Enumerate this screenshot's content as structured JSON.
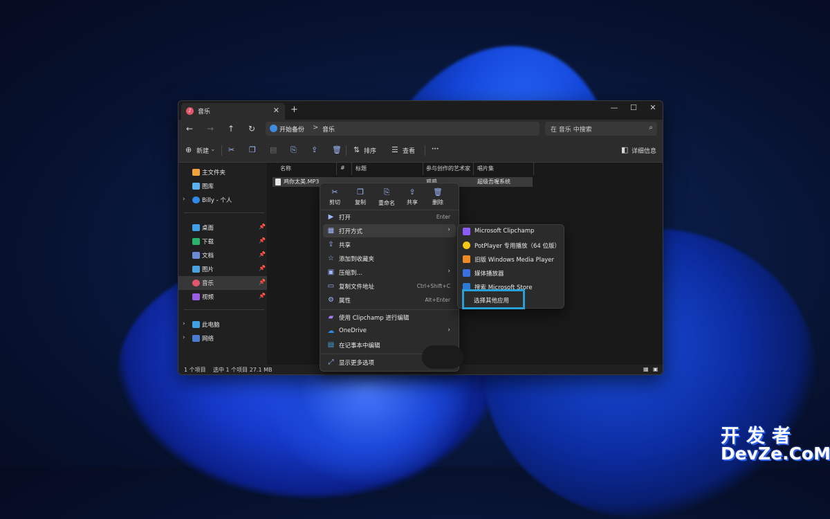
{
  "window": {
    "tab_title": "音乐",
    "tab_close": "✕",
    "tab_add": "+",
    "controls": {
      "minimize": "—",
      "maximize": "☐",
      "close": "✕"
    }
  },
  "address_bar": {
    "back": "←",
    "forward": "→",
    "up": "↑",
    "refresh": "↻",
    "path": [
      "开始备份",
      "音乐"
    ],
    "separator": ">",
    "search_placeholder": "在 音乐 中搜索"
  },
  "toolbar": {
    "new_label": "新建",
    "sort_label": "排序",
    "view_label": "查看",
    "more": "···",
    "details_label": "详细信息"
  },
  "sidebar": {
    "top_items": [
      {
        "label": "主文件夹",
        "icon": "home-icon"
      },
      {
        "label": "图库",
        "icon": "gallery-icon"
      },
      {
        "label": "Billy - 个人",
        "icon": "onedrive-icon"
      }
    ],
    "pinned_items": [
      {
        "label": "桌面",
        "icon": "desktop-icon"
      },
      {
        "label": "下载",
        "icon": "download-icon"
      },
      {
        "label": "文档",
        "icon": "documents-icon"
      },
      {
        "label": "图片",
        "icon": "pictures-icon"
      },
      {
        "label": "音乐",
        "icon": "music-icon",
        "selected": true
      },
      {
        "label": "视频",
        "icon": "videos-icon"
      }
    ],
    "bottom_items": [
      {
        "label": "此电脑",
        "icon": "pc-icon"
      },
      {
        "label": "网络",
        "icon": "network-icon"
      }
    ]
  },
  "file_list": {
    "columns": [
      "名称",
      "#",
      "标题",
      "参与创作的艺术家",
      "唱片集"
    ],
    "rows": [
      {
        "name": "鸡你太美.MP3",
        "artist": "鸡鸡",
        "album": "超级吾喔系统"
      }
    ]
  },
  "status_bar": {
    "count": "1 个项目",
    "selection": "选中 1 个项目 27.1 MB"
  },
  "context_menu": {
    "top_actions": [
      {
        "label": "剪切",
        "icon": "cut-icon"
      },
      {
        "label": "复制",
        "icon": "copy-icon"
      },
      {
        "label": "重命名",
        "icon": "rename-icon"
      },
      {
        "label": "共享",
        "icon": "share-icon"
      },
      {
        "label": "删除",
        "icon": "delete-icon"
      }
    ],
    "items": [
      {
        "label": "打开",
        "shortcut": "Enter",
        "icon": "open-icon"
      },
      {
        "label": "打开方式",
        "submenu": true,
        "icon": "open-with-icon"
      },
      {
        "label": "共享",
        "icon": "share-icon"
      },
      {
        "label": "添加到收藏夹",
        "icon": "star-icon"
      },
      {
        "label": "压缩到...",
        "submenu": true,
        "icon": "zip-icon"
      },
      {
        "label": "复制文件地址",
        "shortcut": "Ctrl+Shift+C",
        "icon": "copy-path-icon"
      },
      {
        "label": "属性",
        "shortcut": "Alt+Enter",
        "icon": "properties-icon"
      },
      {
        "label": "使用 Clipchamp 进行编辑",
        "icon": "clipchamp-icon"
      },
      {
        "label": "OneDrive",
        "submenu": true,
        "icon": "onedrive-icon"
      },
      {
        "label": "在记事本中编辑",
        "icon": "notepad-icon"
      },
      {
        "label": "显示更多选项",
        "icon": "more-options-icon"
      }
    ]
  },
  "open_with_submenu": {
    "items": [
      {
        "label": "Microsoft Clipchamp",
        "color": "#8b5cf6"
      },
      {
        "label": "PotPlayer 专用播放（64 位版）",
        "color": "#f5c518"
      },
      {
        "label": "旧版 Windows Media Player",
        "color": "#f08a24"
      },
      {
        "label": "媒体播放器",
        "color": "#3b6fe0"
      },
      {
        "label": "搜索 Microsoft Store",
        "color": "#2b7bd6"
      }
    ],
    "highlighted": "选择其他应用"
  },
  "watermark": {
    "top": "开发者",
    "bottom": "DevZe.CoM"
  }
}
